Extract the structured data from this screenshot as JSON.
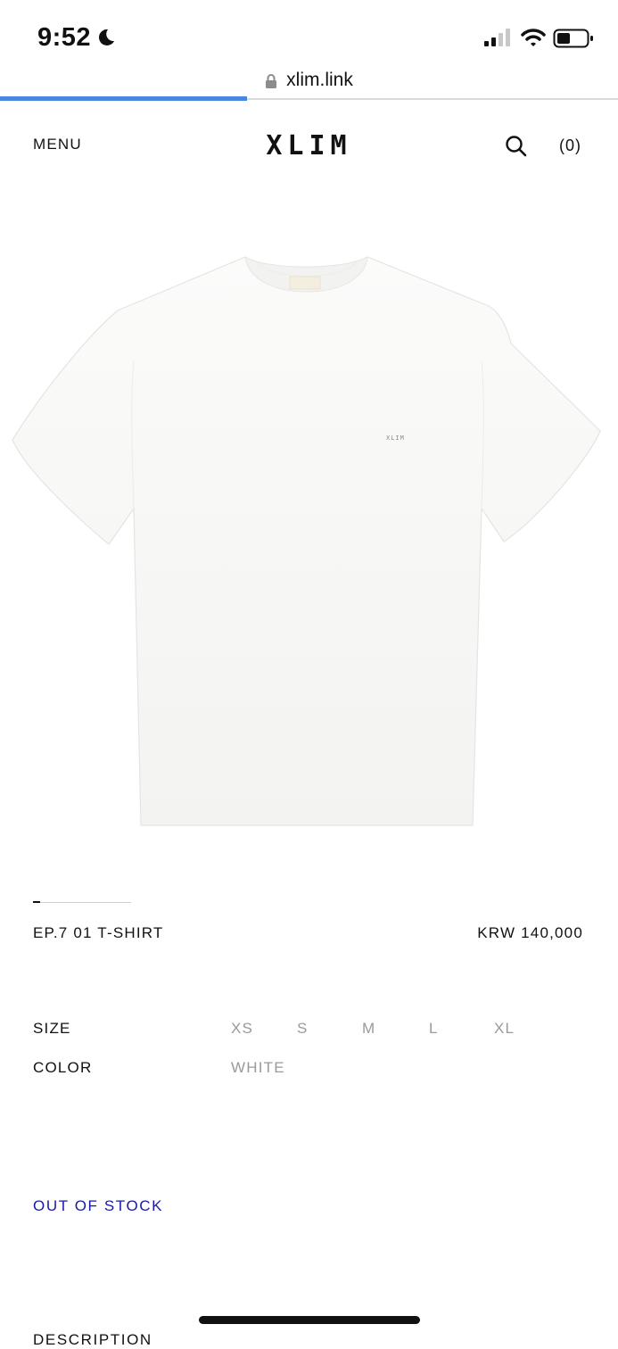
{
  "status_bar": {
    "time": "9:52",
    "icons": [
      "moon-icon",
      "signal-icon",
      "wifi-icon",
      "battery-icon"
    ]
  },
  "browser": {
    "url": "xlim.link",
    "load_progress": 0.4
  },
  "header": {
    "menu_label": "MENU",
    "logo": "XLIM",
    "cart_label": "(0)"
  },
  "product": {
    "name": "EP.7 01 T-SHIRT",
    "price": "KRW 140,000",
    "label_text": "XLIM",
    "size_label": "SIZE",
    "sizes": [
      "XS",
      "S",
      "M",
      "L",
      "XL"
    ],
    "color_label": "COLOR",
    "colors": [
      "WHITE"
    ],
    "stock_status": "OUT OF STOCK",
    "description_heading": "DESCRIPTION"
  },
  "colors": {
    "accent_link": "#1a1aa8",
    "progress_bar": "#4a86e0",
    "muted_option": "#9a9a9a"
  }
}
